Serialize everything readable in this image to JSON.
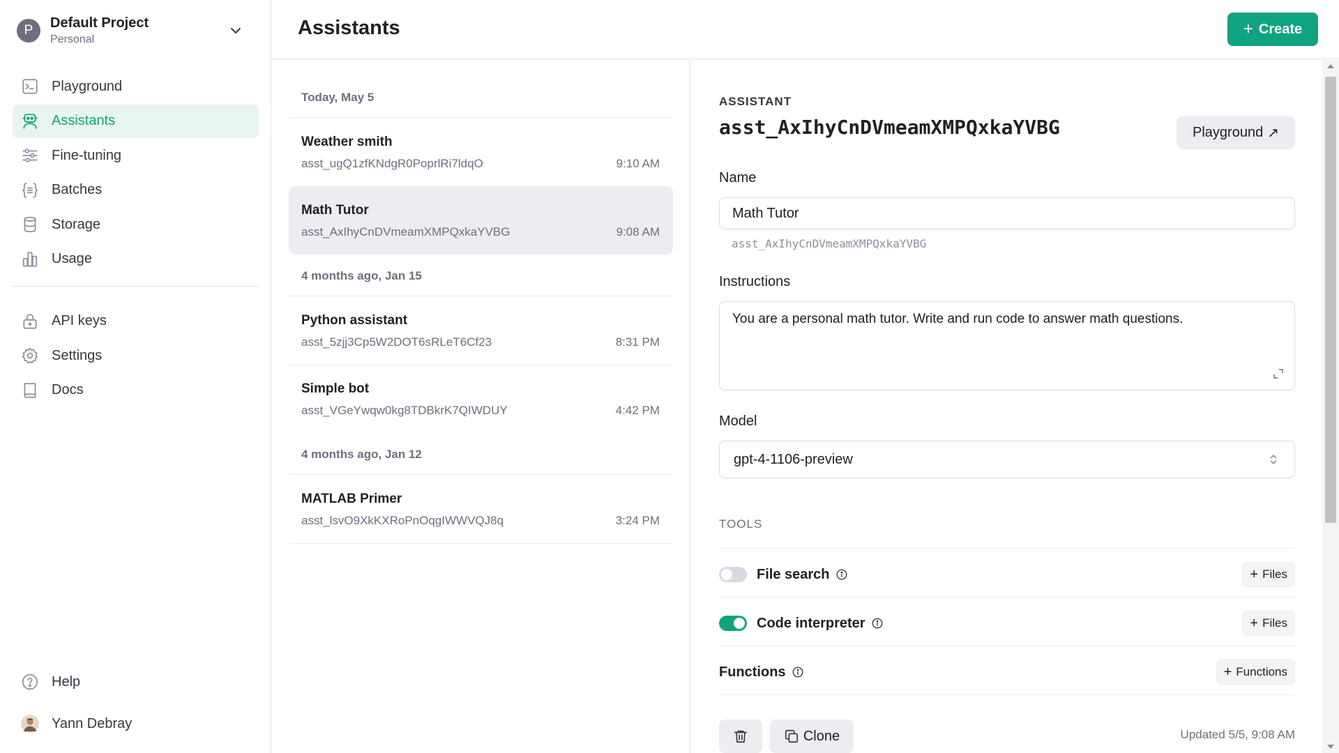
{
  "project": {
    "avatar_letter": "P",
    "name": "Default Project",
    "type": "Personal"
  },
  "nav": {
    "playground": "Playground",
    "assistants": "Assistants",
    "fine_tuning": "Fine-tuning",
    "batches": "Batches",
    "storage": "Storage",
    "usage": "Usage",
    "api_keys": "API keys",
    "settings": "Settings",
    "docs": "Docs",
    "help": "Help"
  },
  "user": {
    "name": "Yann Debray"
  },
  "header": {
    "title": "Assistants",
    "create_label": "Create",
    "create_plus": "+"
  },
  "list": {
    "groups": [
      {
        "label": "Today, May 5"
      },
      {
        "label": "4 months ago, Jan 15"
      },
      {
        "label": "4 months ago, Jan 12"
      }
    ],
    "items": [
      {
        "name": "Weather smith",
        "id": "asst_ugQ1zfKNdgR0PoprlRi7ldqO",
        "time": "9:10 AM"
      },
      {
        "name": "Math Tutor",
        "id": "asst_AxIhyCnDVmeamXMPQxkaYVBG",
        "time": "9:08 AM"
      },
      {
        "name": "Python assistant",
        "id": "asst_5zjj3Cp5W2DOT6sRLeT6Cf23",
        "time": "8:31 PM"
      },
      {
        "name": "Simple bot",
        "id": "asst_VGeYwqw0kg8TDBkrK7QIWDUY",
        "time": "4:42 PM"
      },
      {
        "name": "MATLAB Primer",
        "id": "asst_lsvO9XkKXRoPnOqgIWWVQJ8q",
        "time": "3:24 PM"
      }
    ]
  },
  "detail": {
    "section_label": "ASSISTANT",
    "assistant_id": "asst_AxIhyCnDVmeamXMPQxkaYVBG",
    "playground_label": "Playground",
    "playground_arrow": "↗",
    "name_label": "Name",
    "name_value": "Math Tutor",
    "name_id": "asst_AxIhyCnDVmeamXMPQxkaYVBG",
    "instructions_label": "Instructions",
    "instructions_value": "You are a personal math tutor. Write and run code to answer math questions.",
    "model_label": "Model",
    "model_value": "gpt-4-1106-preview",
    "tools_label": "TOOLS",
    "tools": {
      "file_search": {
        "label": "File search",
        "enabled": false,
        "button": "Files"
      },
      "code_interpreter": {
        "label": "Code interpreter",
        "enabled": true,
        "button": "Files"
      },
      "functions": {
        "label": "Functions",
        "button": "Functions"
      }
    },
    "clone_label": "Clone",
    "updated": "Updated 5/5, 9:08 AM"
  },
  "colors": {
    "accent": "#10a37f",
    "active_bg": "#e8f5ee",
    "selected_row": "#ececf1"
  }
}
